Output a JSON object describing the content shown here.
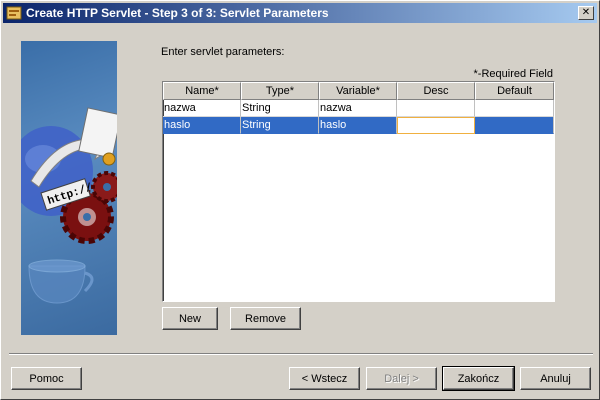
{
  "window": {
    "title": "Create HTTP Servlet - Step 3 of 3: Servlet Parameters"
  },
  "prompt": "Enter servlet parameters:",
  "required_note": "*-Required Field",
  "side_art": {
    "url_label": "http://"
  },
  "table": {
    "columns": [
      "Name*",
      "Type*",
      "Variable*",
      "Desc",
      "Default"
    ],
    "rows": [
      [
        "nazwa",
        "String",
        "nazwa",
        "",
        ""
      ],
      [
        "haslo",
        "String",
        "haslo",
        "",
        ""
      ]
    ]
  },
  "buttons": {
    "new": "New",
    "remove": "Remove",
    "help": "Pomoc",
    "back": "< Wstecz",
    "next": "Dalej >",
    "finish": "Zakończ",
    "cancel": "Anuluj"
  },
  "colors": {
    "title_start": "#0a246a",
    "title_end": "#a6caf0",
    "selection": "#316ac5",
    "face": "#d4d0c8"
  }
}
